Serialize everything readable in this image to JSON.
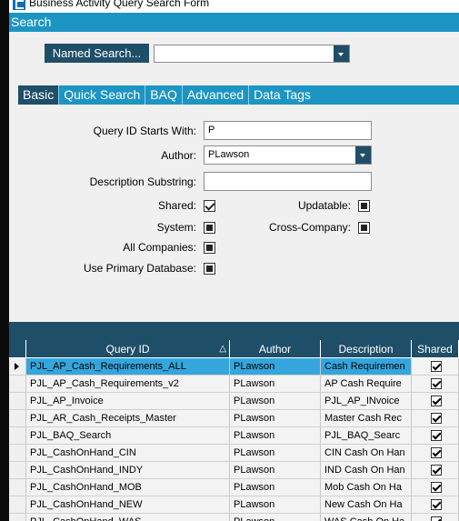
{
  "window": {
    "title": "Business Activity Query Search Form"
  },
  "search_header": "Search",
  "named_search": {
    "button_label": "Named Search...",
    "value": ""
  },
  "tabs": [
    {
      "label": "Basic",
      "active": true
    },
    {
      "label": "Quick Search",
      "active": false
    },
    {
      "label": "BAQ",
      "active": false
    },
    {
      "label": "Advanced",
      "active": false
    },
    {
      "label": "Data Tags",
      "active": false
    }
  ],
  "form": {
    "query_id_label": "Query ID Starts With:",
    "query_id_value": "P",
    "author_label": "Author:",
    "author_value": "PLawson",
    "description_label": "Description Substring:",
    "description_value": "",
    "shared_label": "Shared:",
    "shared_checked": true,
    "updatable_label": "Updatable:",
    "system_label": "System:",
    "cross_company_label": "Cross-Company:",
    "all_companies_label": "All Companies:",
    "use_primary_db_label": "Use Primary Database:"
  },
  "grid": {
    "columns": [
      "Query ID",
      "Author",
      "Description",
      "Shared"
    ],
    "sort_indicator": "△",
    "rows": [
      {
        "query_id": "PJL_AP_Cash_Requirements_ALL",
        "author": "PLawson",
        "description": "Cash Requiremen",
        "shared": true,
        "selected": true
      },
      {
        "query_id": "PJL_AP_Cash_Requirements_v2",
        "author": "PLawson",
        "description": "AP Cash Require",
        "shared": true,
        "selected": false
      },
      {
        "query_id": "PJL_AP_Invoice",
        "author": "PLawson",
        "description": "PJL_AP_INvoice",
        "shared": true,
        "selected": false
      },
      {
        "query_id": "PJL_AR_Cash_Receipts_Master",
        "author": "PLawson",
        "description": "Master Cash Rec",
        "shared": true,
        "selected": false
      },
      {
        "query_id": "PJL_BAQ_Search",
        "author": "PLawson",
        "description": "PJL_BAQ_Searc",
        "shared": true,
        "selected": false
      },
      {
        "query_id": "PJL_CashOnHand_CIN",
        "author": "PLawson",
        "description": "CIN Cash On Han",
        "shared": true,
        "selected": false
      },
      {
        "query_id": "PJL_CashOnHand_INDY",
        "author": "PLawson",
        "description": "IND Cash On Han",
        "shared": true,
        "selected": false
      },
      {
        "query_id": "PJL_CashOnHand_MOB",
        "author": "PLawson",
        "description": "Mob Cash On Ha",
        "shared": true,
        "selected": false
      },
      {
        "query_id": "PJL_CashOnHand_NEW",
        "author": "PLawson",
        "description": "New Cash On Ha",
        "shared": true,
        "selected": false
      },
      {
        "query_id": "PJL_CashOnHand_WAS",
        "author": "PLawson",
        "description": "WAS Cash On Ha",
        "shared": true,
        "selected": false
      }
    ]
  }
}
